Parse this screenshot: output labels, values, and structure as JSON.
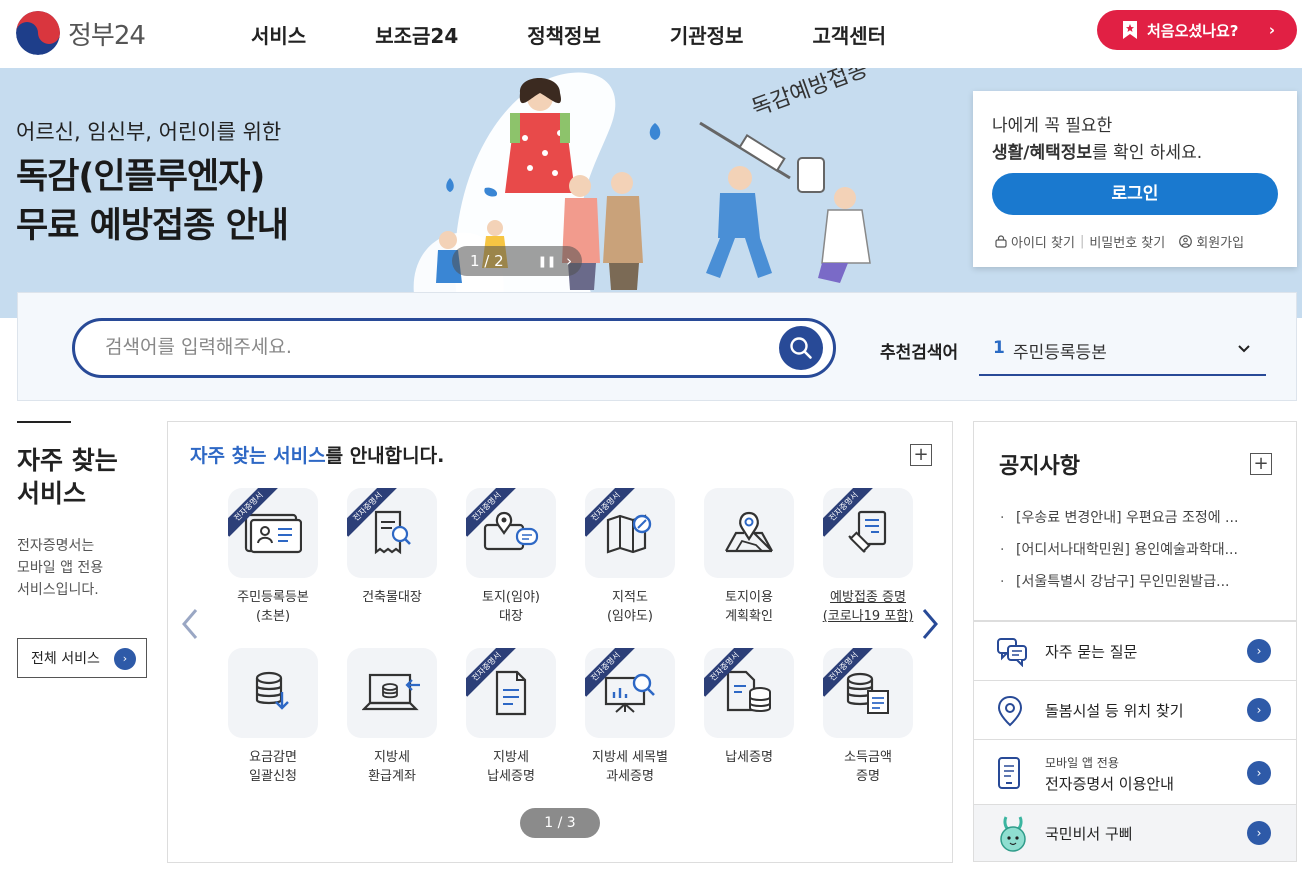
{
  "header": {
    "logo_text": "정부24",
    "nav": [
      "서비스",
      "보조금24",
      "정책정보",
      "기관정보",
      "고객센터"
    ],
    "first_visit": "처음오셨나요?"
  },
  "banner": {
    "subtitle": "어르신, 임신부, 어린이를 위한",
    "title_line1": "독감(인플루엔자)",
    "title_line2": "무료 예방접종 안내",
    "art_text": "독감예방접종",
    "slide_indicator": "1 / 2"
  },
  "login": {
    "msg1": "나에게 꼭 필요한",
    "msg2_bold": "생활/혜택정보",
    "msg2_rest": "를 확인 하세요.",
    "button": "로그인",
    "find_id": "아이디 찾기",
    "find_pw": "비밀번호 찾기",
    "signup": "회원가입"
  },
  "search": {
    "placeholder": "검색어를 입력해주세요.",
    "recommend_label": "추천검색어",
    "recommend_rank": "1",
    "recommend_term": "주민등록등본"
  },
  "intro": {
    "title_line1": "자주 찾는",
    "title_line2": "서비스",
    "desc_line1": "전자증명서는",
    "desc_line2": "모바일 앱 전용",
    "desc_line3": "서비스입니다.",
    "all_button": "전체 서비스"
  },
  "services": {
    "title_highlight": "자주 찾는 서비스",
    "title_rest": "를 안내합니다.",
    "ribbon_label": "전자증명서",
    "pager": "1 / 3",
    "items": [
      {
        "l1": "주민등록등본",
        "l2": "(초본)",
        "icon": "id-card-icon"
      },
      {
        "l1": "건축물대장",
        "l2": "",
        "icon": "document-search-icon"
      },
      {
        "l1": "토지(임야)",
        "l2": "대장",
        "icon": "land-chat-icon"
      },
      {
        "l1": "지적도",
        "l2": "(임야도)",
        "icon": "map-search-icon"
      },
      {
        "l1": "토지이용",
        "l2": "계획확인",
        "icon": "map-pin-icon"
      },
      {
        "l1": "예방접종 증명",
        "l2": "(코로나19 포함)",
        "icon": "vaccine-icon"
      },
      {
        "l1": "요금감면",
        "l2": "일괄신청",
        "icon": "database-download-icon"
      },
      {
        "l1": "지방세",
        "l2": "환급계좌",
        "icon": "laptop-coins-icon"
      },
      {
        "l1": "지방세",
        "l2": "납세증명",
        "icon": "document-icon"
      },
      {
        "l1": "지방세 세목별",
        "l2": "과세증명",
        "icon": "chart-board-icon"
      },
      {
        "l1": "납세증명",
        "l2": "",
        "icon": "document-coins-icon"
      },
      {
        "l1": "소득금액",
        "l2": "증명",
        "icon": "coins-document-icon"
      }
    ]
  },
  "notice": {
    "title": "공지사항",
    "items": [
      "[우송료 변경안내] 우편요금 조정에 ...",
      "[어디서나대학민원] 용인예술과학대...",
      "[서울특별시 강남구] 무인민원발급..."
    ]
  },
  "quick_links": {
    "faq": "자주 묻는 질문",
    "care": "돌봄시설 등 위치 찾기",
    "mobile_small": "모바일 앱 전용",
    "mobile": "전자증명서 이용안내",
    "gubbi": "국민비서 구삐"
  },
  "colors": {
    "accent_red": "#e12044",
    "primary_blue": "#284a97",
    "login_blue": "#1a79cf",
    "banner_bg": "#c6dcef"
  }
}
